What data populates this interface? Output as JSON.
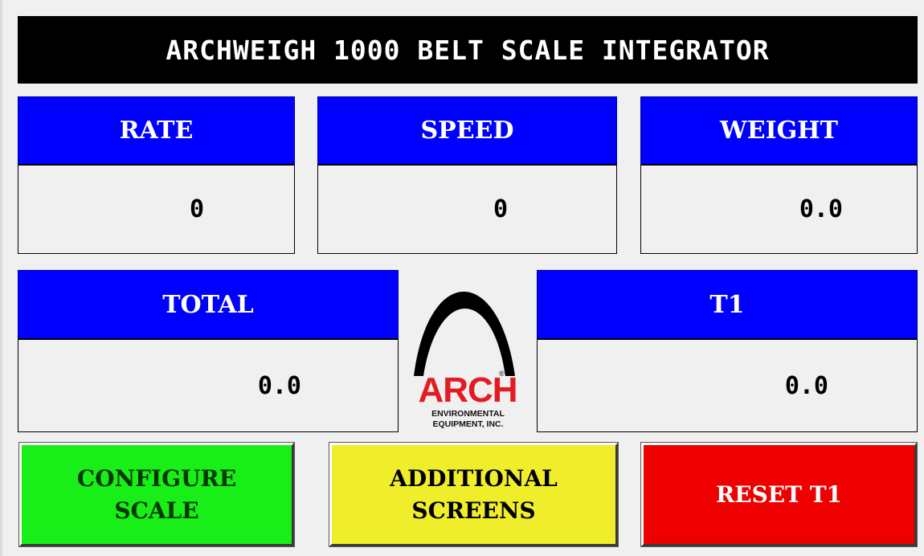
{
  "title": "ARCHWEIGH 1000 BELT SCALE INTEGRATOR",
  "panels": {
    "rate": {
      "label": "RATE",
      "value": "0"
    },
    "speed": {
      "label": "SPEED",
      "value": "0"
    },
    "weight": {
      "label": "WEIGHT",
      "value": "0.0"
    },
    "total": {
      "label": "TOTAL",
      "value": "0.0"
    },
    "t1": {
      "label": "T1",
      "value": "0.0"
    }
  },
  "logo": {
    "name": "ARCH",
    "line1": "ENVIRONMENTAL",
    "line2": "EQUIPMENT, INC.",
    "reg": "®"
  },
  "buttons": {
    "configure": "CONFIGURE\nSCALE",
    "additional": "ADDITIONAL\nSCREENS",
    "reset": "RESET T1"
  },
  "colors": {
    "header_blue": "#0000ff",
    "title_bg": "#000000",
    "configure_bg": "#18ee18",
    "additional_bg": "#f0ee2a",
    "reset_bg": "#ee0000",
    "logo_red": "#e41b23"
  }
}
